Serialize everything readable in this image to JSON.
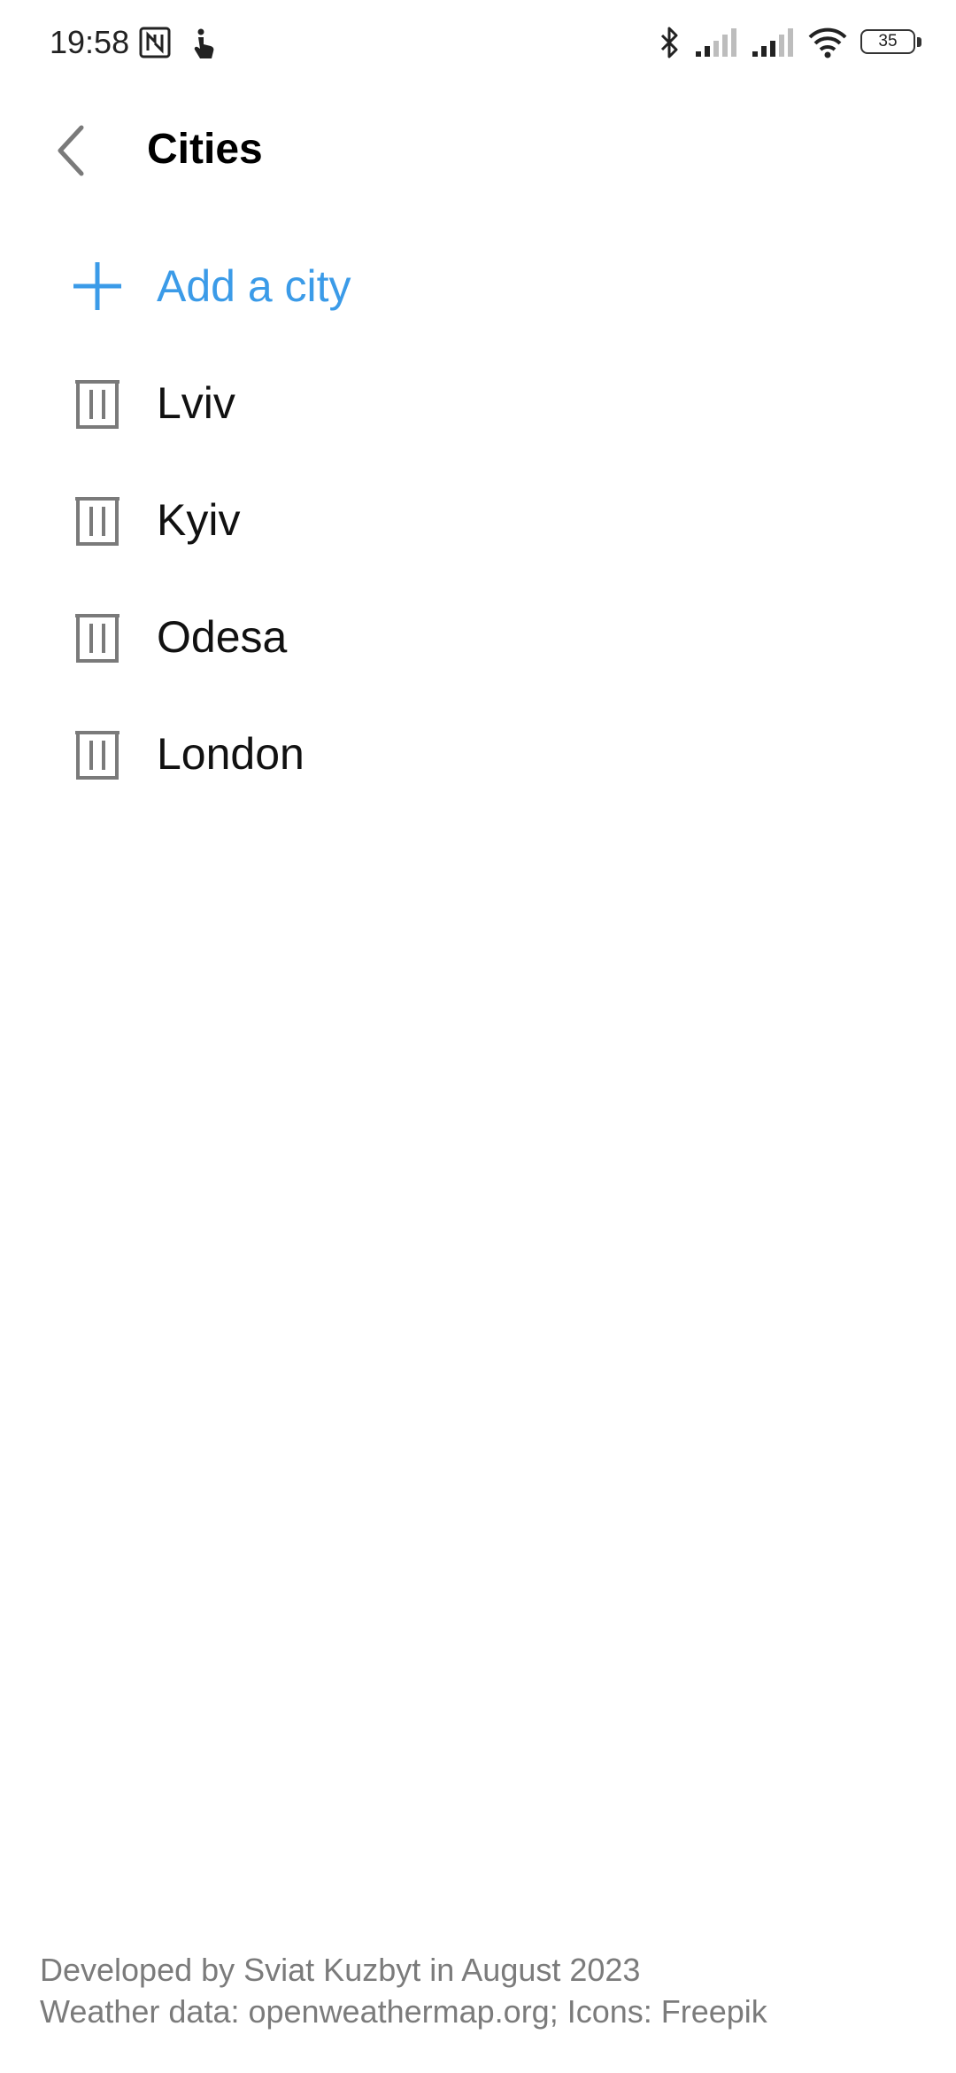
{
  "status_bar": {
    "time": "19:58",
    "battery_level": "35",
    "icons": [
      "nfc-icon",
      "touch-icon",
      "bluetooth-icon",
      "signal-icon",
      "signal-icon",
      "wifi-icon",
      "battery-icon"
    ]
  },
  "header": {
    "title": "Cities",
    "back_icon": "chevron-left-icon"
  },
  "actions": {
    "add_city_label": "Add a city",
    "add_icon": "plus-icon"
  },
  "cities": [
    {
      "name": "Lviv",
      "icon": "trash-icon"
    },
    {
      "name": "Kyiv",
      "icon": "trash-icon"
    },
    {
      "name": "Odesa",
      "icon": "trash-icon"
    },
    {
      "name": "London",
      "icon": "trash-icon"
    }
  ],
  "footer": {
    "line1": "Developed by Sviat Kuzbyt in August 2023",
    "line2": "Weather data: openweathermap.org; Icons: Freepik"
  },
  "colors": {
    "accent": "#3b9be8",
    "icon_gray": "#7a7a7a",
    "footer_text": "#7b7b7b",
    "background": "#ffffff"
  }
}
